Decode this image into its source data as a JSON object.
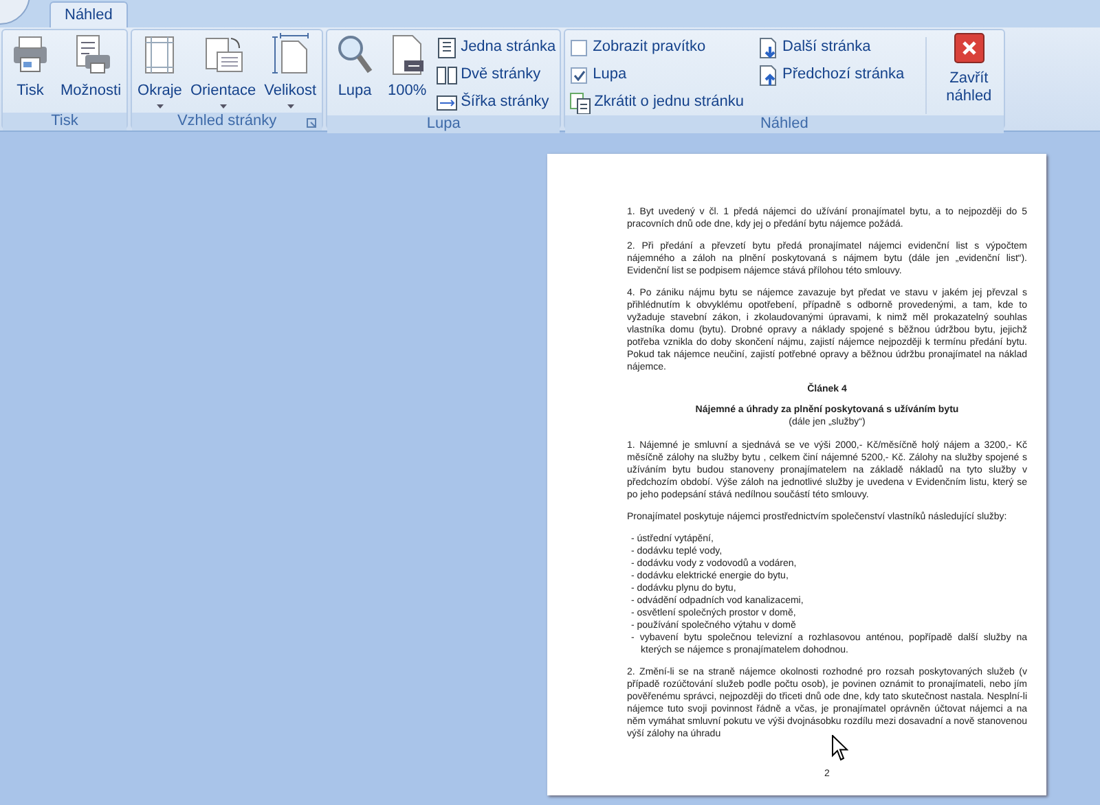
{
  "tabs": [
    {
      "label": "Náhled",
      "selected": true
    }
  ],
  "ribbon_groups": [
    {
      "label": "Tisk",
      "launcher": false,
      "items": [
        {
          "kind": "large",
          "label": "Tisk",
          "dropdown": false
        },
        {
          "kind": "large",
          "label": "Možnosti",
          "dropdown": false
        }
      ]
    },
    {
      "label": "Vzhled stránky",
      "launcher": true,
      "items": [
        {
          "kind": "large",
          "label": "Okraje",
          "dropdown": true
        },
        {
          "kind": "large",
          "label": "Orientace",
          "dropdown": true
        },
        {
          "kind": "large",
          "label": "Velikost",
          "dropdown": true
        }
      ]
    },
    {
      "label": "Lupa",
      "launcher": false,
      "items": [
        {
          "kind": "large",
          "label": "Lupa",
          "dropdown": false
        },
        {
          "kind": "large",
          "label": "100%",
          "dropdown": false
        },
        {
          "kind": "stack",
          "items": [
            {
              "kind": "small",
              "label": "Jedna stránka"
            },
            {
              "kind": "small",
              "label": "Dvě stránky"
            },
            {
              "kind": "small",
              "label": "Šířka stránky"
            }
          ]
        }
      ]
    },
    {
      "label": "Náhled",
      "launcher": false,
      "items": [
        {
          "kind": "stack",
          "items": [
            {
              "kind": "checkbox",
              "label": "Zobrazit pravítko",
              "checked": false
            },
            {
              "kind": "checkbox",
              "label": "Lupa",
              "checked": true
            },
            {
              "kind": "small",
              "label": "Zkrátit o jednu stránku"
            }
          ]
        },
        {
          "kind": "stack",
          "items": [
            {
              "kind": "small",
              "label": "Další stránka"
            },
            {
              "kind": "small",
              "label": "Předchozí stránka"
            }
          ]
        },
        {
          "kind": "separator"
        },
        {
          "kind": "close",
          "label": "Zavřít náhled"
        }
      ]
    }
  ],
  "page": {
    "blocks": [
      {
        "kind": "para",
        "text": "1. Byt uvedený v čl. 1 předá nájemci do užívání pronajímatel bytu, a to nejpozději do 5 pracovních dnů ode dne, kdy jej o předání bytu nájemce požádá."
      },
      {
        "kind": "para",
        "text": "2. Při předání a převzetí bytu předá pronajímatel nájemci evidenční list s výpočtem nájemného a záloh na plnění poskytovaná s nájmem bytu (dále jen „evidenční list“). Evidenční list se podpisem nájemce stává přílohou této smlouvy."
      },
      {
        "kind": "para",
        "text": "4. Po zániku nájmu bytu se nájemce zavazuje byt předat ve stavu v jakém jej převzal s přihlédnutím k obvyklému opotřebení, případně s odborně provedenými, a tam, kde to vyžaduje stavební zákon, i zkolaudovanými úpravami, k nimž měl prokazatelný souhlas vlastníka domu (bytu). Drobné opravy a náklady spojené s běžnou údržbou bytu, jejichž potřeba vznikla do doby skončení nájmu, zajistí nájemce nejpozději k termínu předání bytu. Pokud tak nájemce neučiní, zajistí potřebné opravy a běžnou údržbu pronajímatel na náklad nájemce."
      },
      {
        "kind": "heading",
        "text": "Článek 4"
      },
      {
        "kind": "heading",
        "text": "Nájemné a úhrady za plnění poskytovaná s užíváním bytu"
      },
      {
        "kind": "subheading",
        "text": "(dále jen „služby“)"
      },
      {
        "kind": "para",
        "text": "1. Nájemné je smluvní a sjednává se ve výši 2000,- Kč/měsíčně holý nájem a 3200,- Kč měsíčně zálohy na služby bytu , celkem činí nájemné 5200,- Kč. Zálohy na služby spojené s užíváním bytu budou stanoveny pronajímatelem na základě nákladů na tyto služby v předchozím období. Výše záloh na jednotlivé služby je uvedena v Evidenčním listu, který se po jeho podepsání stává nedílnou součástí této smlouvy."
      },
      {
        "kind": "para",
        "text": "Pronajímatel poskytuje nájemci prostřednictvím společenství vlastníků následující služby:"
      },
      {
        "kind": "list",
        "items": [
          "- ústřední vytápění,",
          "- dodávku teplé vody,",
          "- dodávku vody z vodovodů a vodáren,",
          "- dodávku elektrické energie do bytu,",
          "- dodávku plynu do bytu,",
          "- odvádění odpadních vod kanalizacemi,",
          "- osvětlení společných prostor v domě,",
          "- používání společného výtahu v domě",
          "- vybavení bytu společnou televizní a rozhlasovou anténou, popřípadě další služby na kterých se nájemce s pronajímatelem dohodnou."
        ]
      },
      {
        "kind": "para",
        "text": "2. Změní-li se na straně nájemce okolnosti rozhodné pro rozsah poskytovaných služeb (v případě rozúčtování služeb podle počtu osob), je povinen oznámit to pronajímateli, nebo jím pověřenému správci, nejpozději do třiceti dnů ode dne, kdy tato skutečnost nastala. Nesplní-li nájemce tuto svoji povinnost řádně a včas, je pronajímatel oprávněn účtovat nájemci a na něm vymáhat smluvní pokutu ve výši dvojnásobku rozdílu mezi dosavadní a nově stanovenou výší zálohy na úhradu"
      }
    ],
    "page_number": "2"
  }
}
